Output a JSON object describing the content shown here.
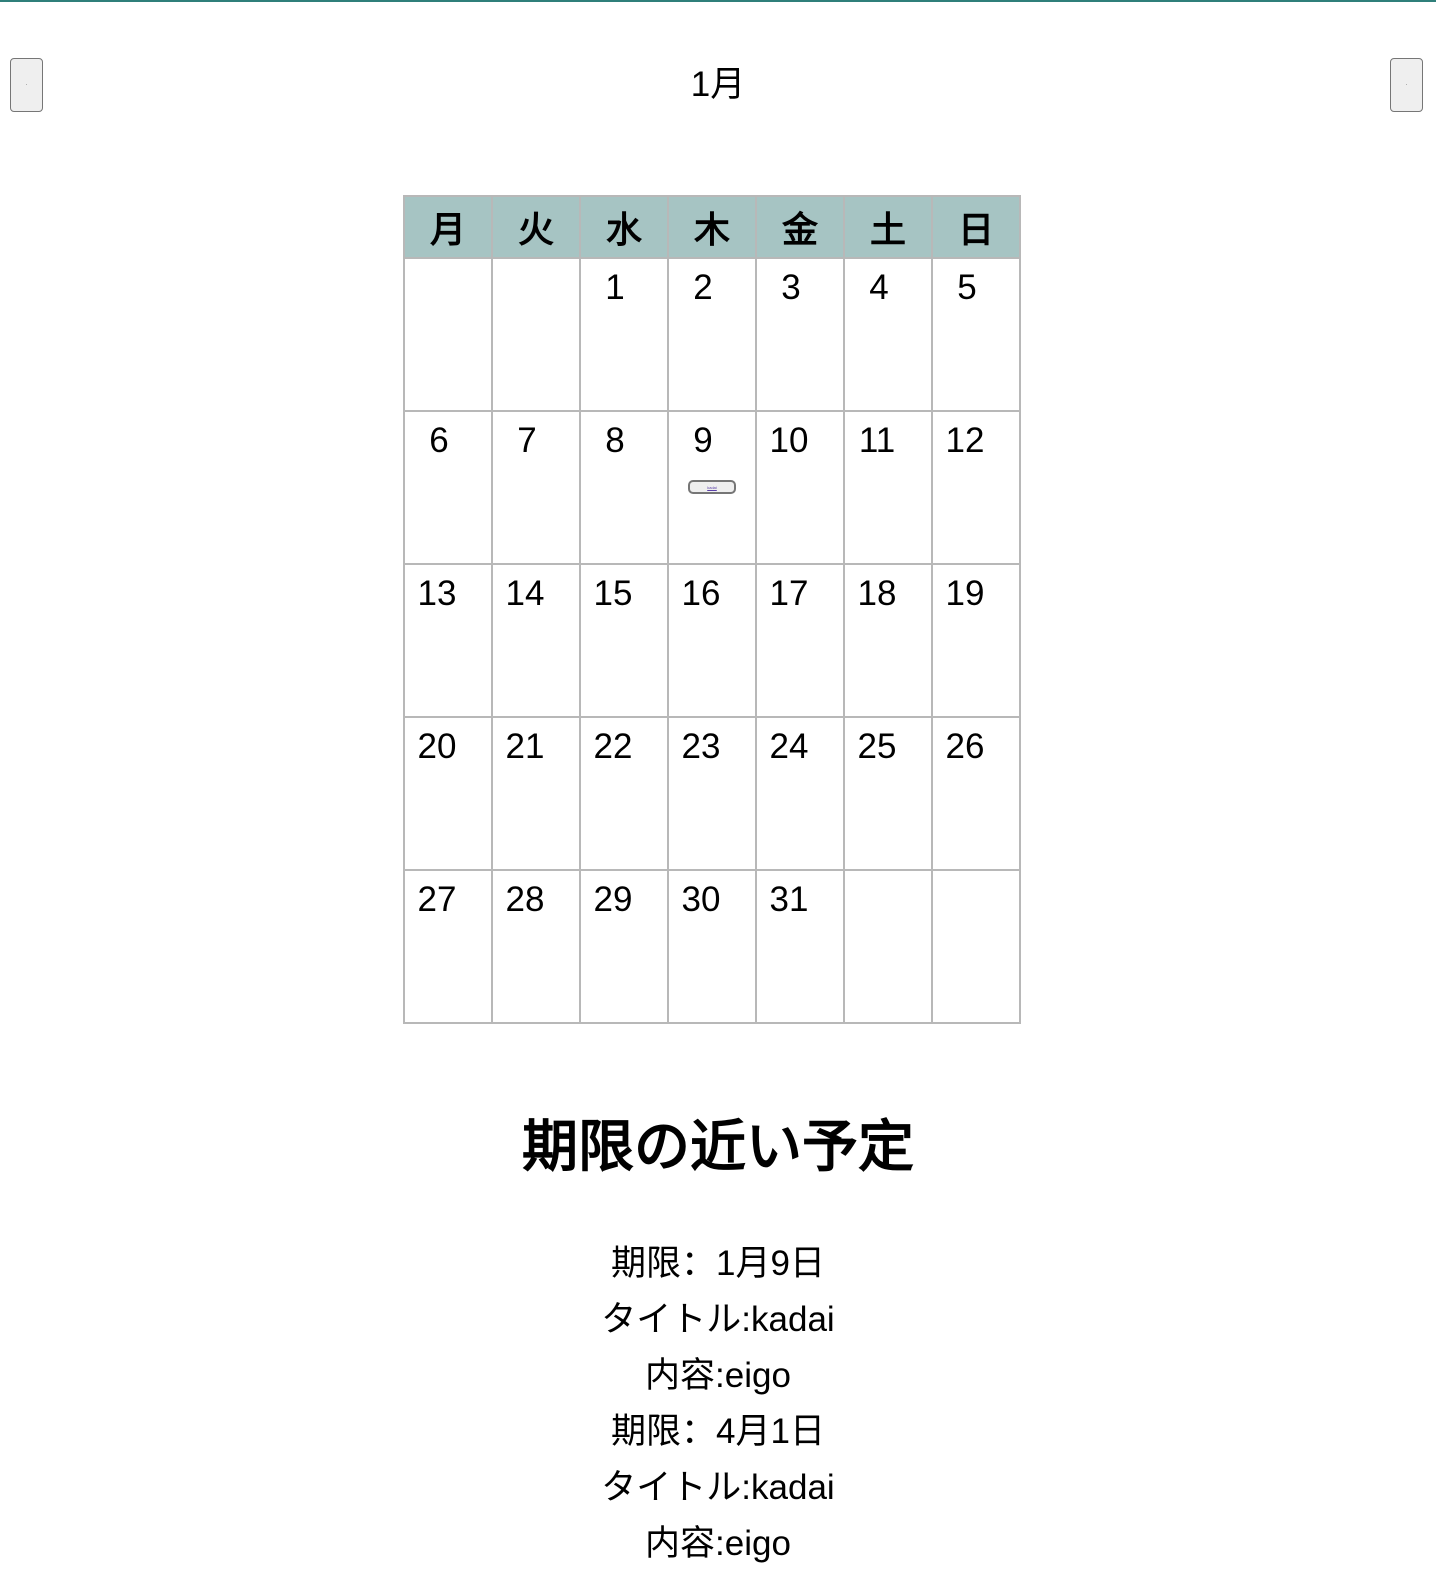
{
  "calendar": {
    "month_title": "1月",
    "prev_button": "·",
    "next_button": "·",
    "weekdays": [
      "月",
      "火",
      "水",
      "木",
      "金",
      "土",
      "日"
    ],
    "weeks": [
      [
        "",
        "",
        "1",
        "2",
        "3",
        "4",
        "5"
      ],
      [
        "6",
        "7",
        "8",
        "9",
        "10",
        "11",
        "12"
      ],
      [
        "13",
        "14",
        "15",
        "16",
        "17",
        "18",
        "19"
      ],
      [
        "20",
        "21",
        "22",
        "23",
        "24",
        "25",
        "26"
      ],
      [
        "27",
        "28",
        "29",
        "30",
        "31",
        "",
        ""
      ]
    ],
    "event_marker": {
      "day": "9",
      "label": "kadai"
    }
  },
  "upcoming": {
    "heading": "期限の近い予定",
    "items": [
      {
        "deadline": "期限：1月9日",
        "title": "タイトル:kadai",
        "content": "内容:eigo"
      },
      {
        "deadline": "期限：4月1日",
        "title": "タイトル:kadai",
        "content": "内容:eigo"
      }
    ]
  }
}
